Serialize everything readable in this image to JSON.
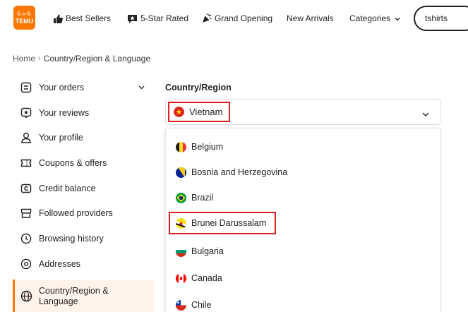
{
  "logo": {
    "text": "TEMU",
    "glyph": "ꕃꕂꕃ"
  },
  "nav": {
    "best_sellers": "Best Sellers",
    "five_star": "5-Star Rated",
    "grand_opening": "Grand Opening",
    "new_arrivals": "New Arrivals",
    "categories": "Categories"
  },
  "search": {
    "value": "tshirts"
  },
  "breadcrumb": {
    "home": "Home",
    "separator": "›",
    "current": "Country/Region & Language"
  },
  "sidebar": {
    "items": [
      {
        "label": "Your orders",
        "icon": "orders-icon"
      },
      {
        "label": "Your reviews",
        "icon": "reviews-icon"
      },
      {
        "label": "Your profile",
        "icon": "profile-icon"
      },
      {
        "label": "Coupons & offers",
        "icon": "coupon-icon"
      },
      {
        "label": "Credit balance",
        "icon": "credit-icon"
      },
      {
        "label": "Followed providers",
        "icon": "store-icon"
      },
      {
        "label": "Browsing history",
        "icon": "history-icon"
      },
      {
        "label": "Addresses",
        "icon": "location-icon"
      },
      {
        "label": "Country/Region & Language",
        "icon": "globe-icon"
      }
    ],
    "active_index": 8
  },
  "country": {
    "label": "Country/Region",
    "selected": "Vietnam",
    "options": [
      "Belgium",
      "Bosnia and Herzegovina",
      "Brazil",
      "Brunei Darussalam",
      "Bulgaria",
      "Canada",
      "Chile"
    ],
    "highlighted_option": "Brunei Darussalam"
  },
  "colors": {
    "brand": "#fb7701",
    "highlight_border": "#e21f1f",
    "active_bg": "#fff4ec"
  }
}
